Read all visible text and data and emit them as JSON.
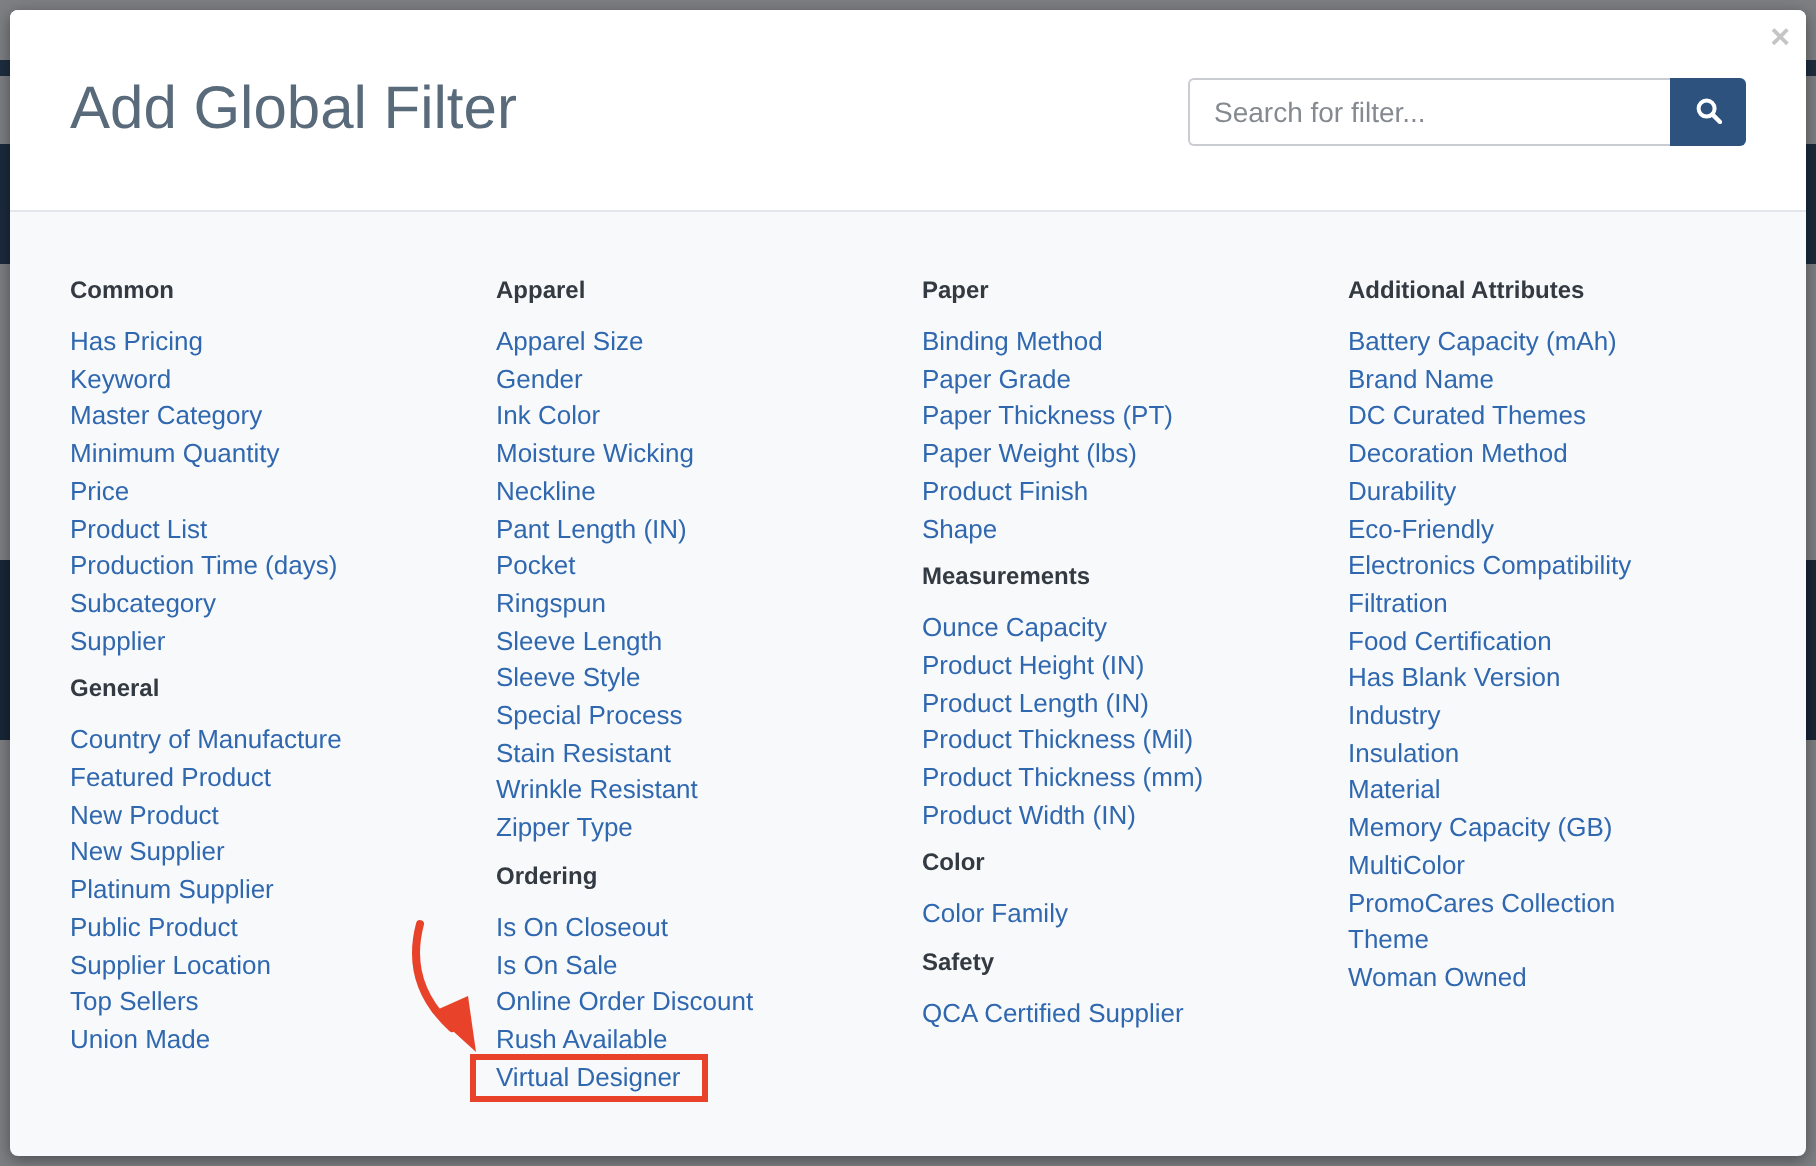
{
  "dialog": {
    "title": "Add Global Filter",
    "close": "×",
    "search": {
      "placeholder": "Search for filter..."
    }
  },
  "columns": [
    [
      {
        "heading": "Common",
        "items": [
          {
            "label": "Has Pricing",
            "highlighted": false
          },
          {
            "label": "Keyword",
            "highlighted": false
          },
          {
            "label": "Master Category",
            "highlighted": false
          },
          {
            "label": "Minimum Quantity",
            "highlighted": false
          },
          {
            "label": "Price",
            "highlighted": false
          },
          {
            "label": "Product List",
            "highlighted": false
          },
          {
            "label": "Production Time (days)",
            "highlighted": false
          },
          {
            "label": "Subcategory",
            "highlighted": false
          },
          {
            "label": "Supplier",
            "highlighted": false
          }
        ]
      },
      {
        "heading": "General",
        "items": [
          {
            "label": "Country of Manufacture",
            "highlighted": false
          },
          {
            "label": "Featured Product",
            "highlighted": false
          },
          {
            "label": "New Product",
            "highlighted": false
          },
          {
            "label": "New Supplier",
            "highlighted": false
          },
          {
            "label": "Platinum Supplier",
            "highlighted": false
          },
          {
            "label": "Public Product",
            "highlighted": false
          },
          {
            "label": "Supplier Location",
            "highlighted": false
          },
          {
            "label": "Top Sellers",
            "highlighted": false
          },
          {
            "label": "Union Made",
            "highlighted": false
          }
        ]
      }
    ],
    [
      {
        "heading": "Apparel",
        "items": [
          {
            "label": "Apparel Size",
            "highlighted": false
          },
          {
            "label": "Gender",
            "highlighted": false
          },
          {
            "label": "Ink Color",
            "highlighted": false
          },
          {
            "label": "Moisture Wicking",
            "highlighted": false
          },
          {
            "label": "Neckline",
            "highlighted": false
          },
          {
            "label": "Pant Length (IN)",
            "highlighted": false
          },
          {
            "label": "Pocket",
            "highlighted": false
          },
          {
            "label": "Ringspun",
            "highlighted": false
          },
          {
            "label": "Sleeve Length",
            "highlighted": false
          },
          {
            "label": "Sleeve Style",
            "highlighted": false
          },
          {
            "label": "Special Process",
            "highlighted": false
          },
          {
            "label": "Stain Resistant",
            "highlighted": false
          },
          {
            "label": "Wrinkle Resistant",
            "highlighted": false
          },
          {
            "label": "Zipper Type",
            "highlighted": false
          }
        ]
      },
      {
        "heading": "Ordering",
        "items": [
          {
            "label": "Is On Closeout",
            "highlighted": false
          },
          {
            "label": "Is On Sale",
            "highlighted": false
          },
          {
            "label": "Online Order Discount",
            "highlighted": false
          },
          {
            "label": "Rush Available",
            "highlighted": false
          },
          {
            "label": "Virtual Designer",
            "highlighted": true
          }
        ]
      }
    ],
    [
      {
        "heading": "Paper",
        "items": [
          {
            "label": "Binding Method",
            "highlighted": false
          },
          {
            "label": "Paper Grade",
            "highlighted": false
          },
          {
            "label": "Paper Thickness (PT)",
            "highlighted": false
          },
          {
            "label": "Paper Weight (lbs)",
            "highlighted": false
          },
          {
            "label": "Product Finish",
            "highlighted": false
          },
          {
            "label": "Shape",
            "highlighted": false
          }
        ]
      },
      {
        "heading": "Measurements",
        "items": [
          {
            "label": "Ounce Capacity",
            "highlighted": false
          },
          {
            "label": "Product Height (IN)",
            "highlighted": false
          },
          {
            "label": "Product Length (IN)",
            "highlighted": false
          },
          {
            "label": "Product Thickness (Mil)",
            "highlighted": false
          },
          {
            "label": "Product Thickness (mm)",
            "highlighted": false
          },
          {
            "label": "Product Width (IN)",
            "highlighted": false
          }
        ]
      },
      {
        "heading": "Color",
        "items": [
          {
            "label": "Color Family",
            "highlighted": false
          }
        ]
      },
      {
        "heading": "Safety",
        "items": [
          {
            "label": "QCA Certified Supplier",
            "highlighted": false
          }
        ]
      }
    ],
    [
      {
        "heading": "Additional Attributes",
        "items": [
          {
            "label": "Battery Capacity (mAh)",
            "highlighted": false
          },
          {
            "label": "Brand Name",
            "highlighted": false
          },
          {
            "label": "DC Curated Themes",
            "highlighted": false
          },
          {
            "label": "Decoration Method",
            "highlighted": false
          },
          {
            "label": "Durability",
            "highlighted": false
          },
          {
            "label": "Eco-Friendly",
            "highlighted": false
          },
          {
            "label": "Electronics Compatibility",
            "highlighted": false
          },
          {
            "label": "Filtration",
            "highlighted": false
          },
          {
            "label": "Food Certification",
            "highlighted": false
          },
          {
            "label": "Has Blank Version",
            "highlighted": false
          },
          {
            "label": "Industry",
            "highlighted": false
          },
          {
            "label": "Insulation",
            "highlighted": false
          },
          {
            "label": "Material",
            "highlighted": false
          },
          {
            "label": "Memory Capacity (GB)",
            "highlighted": false
          },
          {
            "label": "MultiColor",
            "highlighted": false
          },
          {
            "label": "PromoCares Collection",
            "highlighted": false
          },
          {
            "label": "Theme",
            "highlighted": false
          },
          {
            "label": "Woman Owned",
            "highlighted": false
          }
        ]
      }
    ]
  ]
}
